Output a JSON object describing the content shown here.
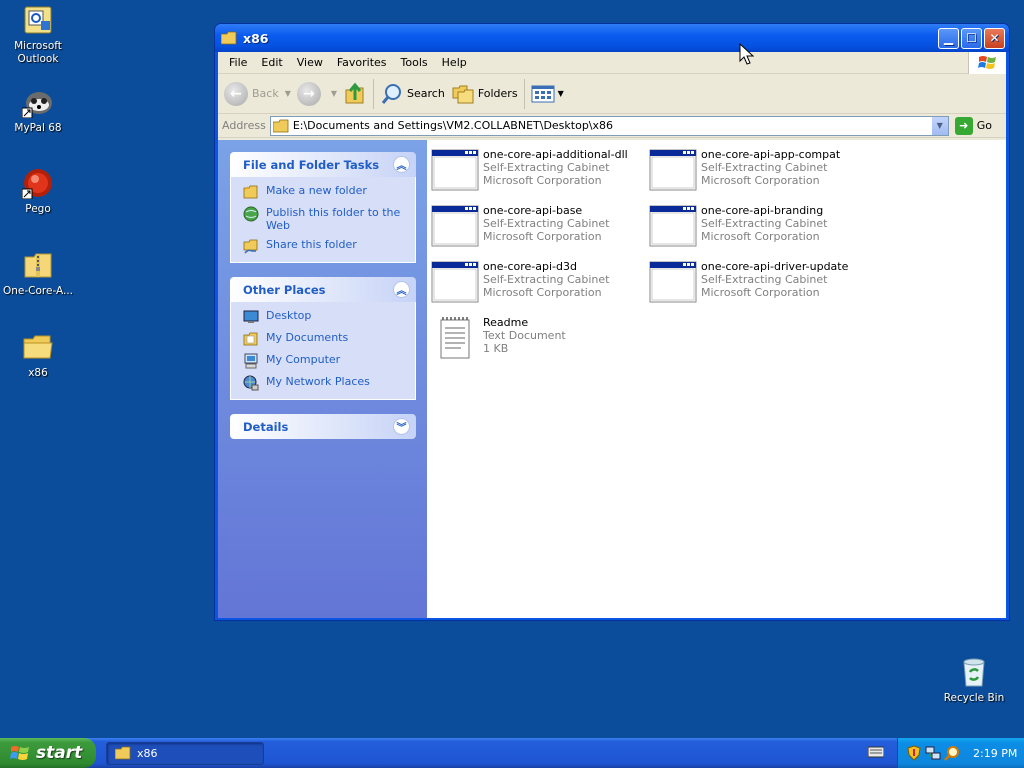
{
  "desktop": {
    "icons": [
      {
        "label": "Microsoft Outlook",
        "icon": "outlook-icon"
      },
      {
        "label": "MyPal 68",
        "icon": "mypal-icon"
      },
      {
        "label": "Pego",
        "icon": "pego-icon"
      },
      {
        "label": "One-Core-A...",
        "icon": "zip-folder-icon"
      },
      {
        "label": "x86",
        "icon": "folder-icon"
      }
    ],
    "recycle_bin": "Recycle Bin"
  },
  "window": {
    "title": "x86",
    "menu": [
      "File",
      "Edit",
      "View",
      "Favorites",
      "Tools",
      "Help"
    ],
    "toolbar": {
      "back": "Back",
      "search": "Search",
      "folders": "Folders"
    },
    "address": {
      "label": "Address",
      "value": "E:\\Documents and Settings\\VM2.COLLABNET\\Desktop\\x86",
      "go": "Go"
    },
    "taskpane": {
      "file_tasks": {
        "title": "File and Folder Tasks",
        "links": [
          "Make a new folder",
          "Publish this folder to the Web",
          "Share this folder"
        ]
      },
      "other_places": {
        "title": "Other Places",
        "links": [
          "Desktop",
          "My Documents",
          "My Computer",
          "My Network Places"
        ]
      },
      "details": {
        "title": "Details"
      }
    },
    "files": [
      {
        "name": "one-core-api-additional-dll",
        "type": "Self-Extracting Cabinet",
        "company": "Microsoft Corporation"
      },
      {
        "name": "one-core-api-app-compat",
        "type": "Self-Extracting Cabinet",
        "company": "Microsoft Corporation"
      },
      {
        "name": "one-core-api-base",
        "type": "Self-Extracting Cabinet",
        "company": "Microsoft Corporation"
      },
      {
        "name": "one-core-api-branding",
        "type": "Self-Extracting Cabinet",
        "company": "Microsoft Corporation"
      },
      {
        "name": "one-core-api-d3d",
        "type": "Self-Extracting Cabinet",
        "company": "Microsoft Corporation"
      },
      {
        "name": "one-core-api-driver-update",
        "type": "Self-Extracting Cabinet",
        "company": "Microsoft Corporation"
      },
      {
        "name": "Readme",
        "type": "Text Document",
        "company": "1 KB"
      }
    ]
  },
  "taskbar": {
    "start": "start",
    "task": "x86",
    "clock": "2:19 PM"
  }
}
